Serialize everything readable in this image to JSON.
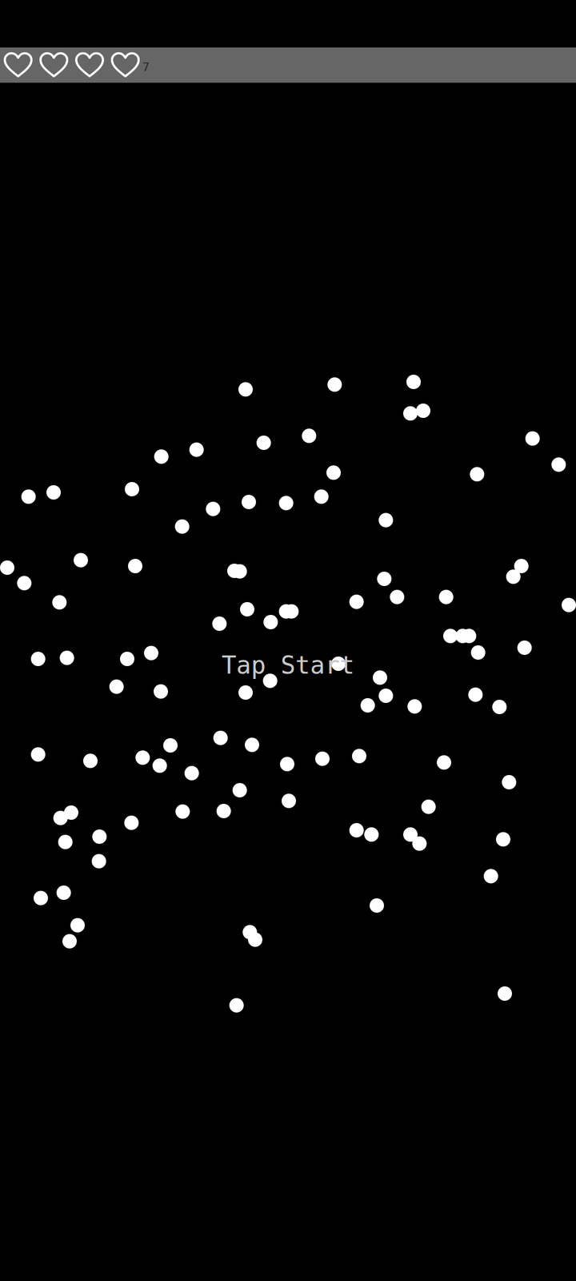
{
  "hud": {
    "lives": [
      {
        "filled": false
      },
      {
        "filled": false
      },
      {
        "filled": false
      },
      {
        "filled": false
      }
    ],
    "score": "7"
  },
  "prompt": "Tap Start"
}
